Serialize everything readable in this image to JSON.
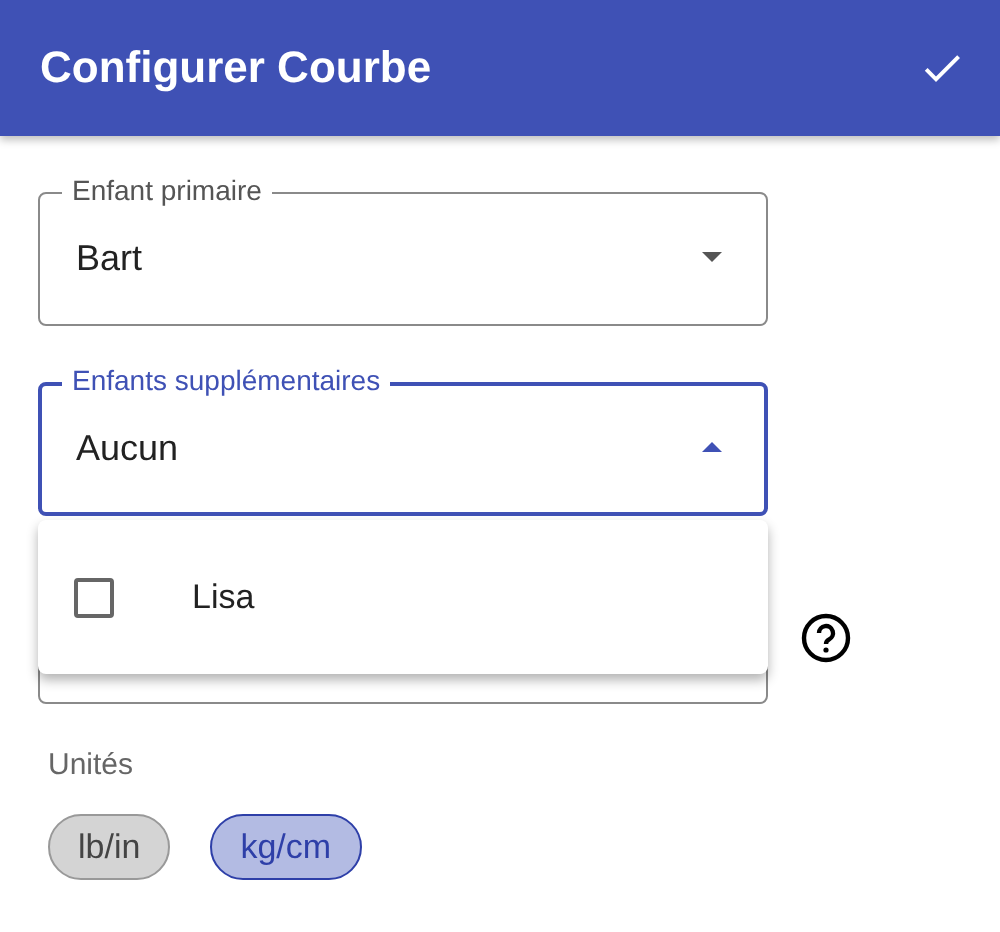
{
  "app_bar": {
    "title": "Configurer Courbe"
  },
  "fields": [
    {
      "label": "Enfant primaire",
      "value": "Bart",
      "focused": false,
      "expanded": false
    },
    {
      "label": "Enfants supplémentaires",
      "value": "Aucun",
      "focused": true,
      "expanded": true
    }
  ],
  "menu": {
    "items": [
      {
        "label": "Lisa",
        "checked": false
      }
    ]
  },
  "units": {
    "label": "Unités",
    "chips": [
      {
        "label": "lb/in",
        "selected": false
      },
      {
        "label": "kg/cm",
        "selected": true
      }
    ]
  }
}
